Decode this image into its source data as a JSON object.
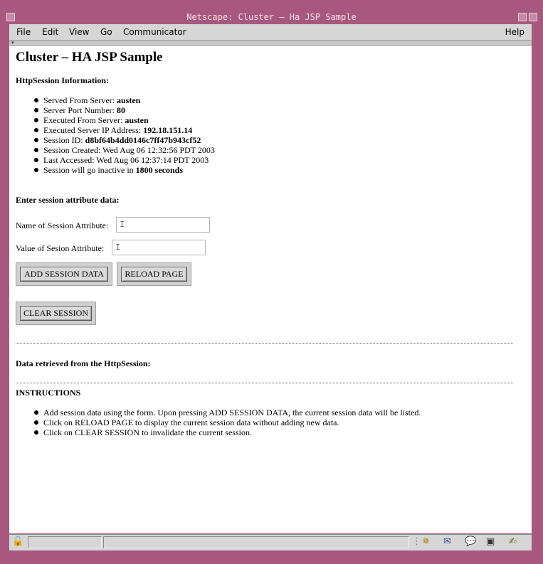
{
  "window": {
    "title": "Netscape: Cluster – Ha JSP Sample"
  },
  "menubar": {
    "file": "File",
    "edit": "Edit",
    "view": "View",
    "go": "Go",
    "communicator": "Communicator",
    "help": "Help"
  },
  "page": {
    "heading": "Cluster – HA JSP Sample",
    "info_heading": "HttpSession Information:",
    "info": [
      {
        "label": "Served From Server: ",
        "value": "austen"
      },
      {
        "label": "Server Port Number: ",
        "value": "80"
      },
      {
        "label": "Executed From Server: ",
        "value": "austen"
      },
      {
        "label": "Executed Server IP Address: ",
        "value": "192.18.151.14"
      },
      {
        "label": "Session ID: ",
        "value": "d8bf64b4dd0146c7ff47b943cf52"
      },
      {
        "label": "Session Created: Wed Aug 06 12:32:56 PDT 2003",
        "value": ""
      },
      {
        "label": "Last Accessed: Wed Aug 06 12:37:14 PDT 2003",
        "value": ""
      },
      {
        "label": "Session will go inactive in ",
        "value": "1800 seconds"
      }
    ],
    "form_heading": "Enter session attribute data:",
    "name_label": "Name of Session Attribute:",
    "name_value": "",
    "value_label": "Value of Sesion Attribute:",
    "value_value": "",
    "add_button": "ADD SESSION DATA",
    "reload_button": "RELOAD PAGE",
    "clear_button": "CLEAR SESSION",
    "retrieved_heading": "Data retrieved from the HttpSession:",
    "instructions_heading": "INSTRUCTIONS",
    "instructions": [
      "Add session data using the form. Upon pressing ADD SESSION DATA, the current session data will be listed.",
      "Click on RELOAD PAGE to display the current session data without adding new data.",
      "Click on CLEAR SESSION to invalidate the current session."
    ]
  },
  "statusbar": {
    "icons": [
      "security-lock-icon",
      "component-bar-navigator-icon",
      "mail-icon",
      "discussion-icon",
      "composer-icon",
      "signed-edit-icon"
    ]
  },
  "colors": {
    "frame": "#a8587e",
    "chrome": "#d6d6d6",
    "page_background": "#ffffff"
  }
}
